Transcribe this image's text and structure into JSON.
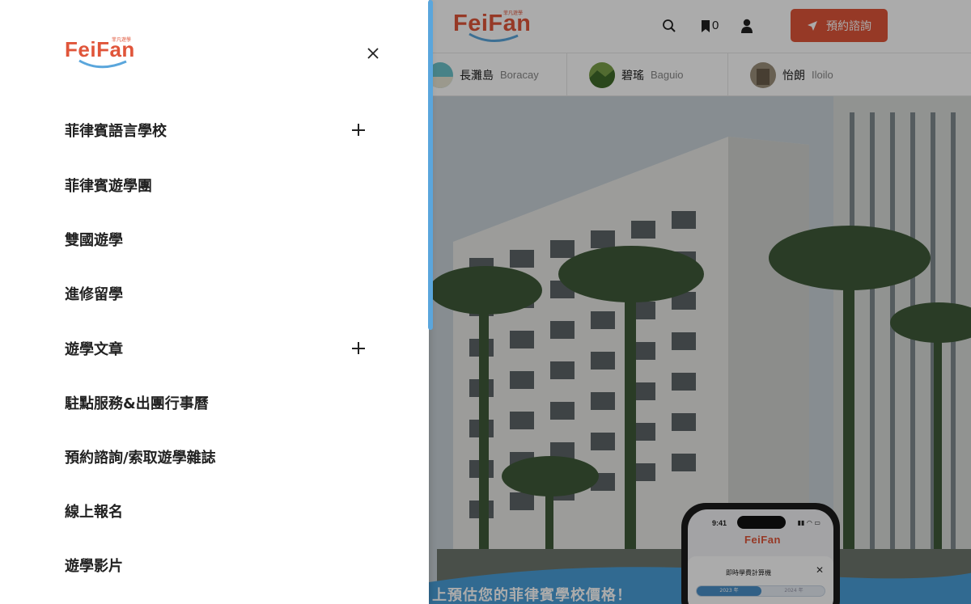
{
  "brand": {
    "name": "FeiFan",
    "tagline": "菲凡遊學",
    "primary_color": "#e0553a",
    "accent_color": "#5aa6dc"
  },
  "header": {
    "bookmark_count": "0",
    "cta_label": "預約諮詢",
    "icons": [
      "search-icon",
      "bookmark-icon",
      "user-icon",
      "send-icon"
    ]
  },
  "regions": [
    {
      "zh": "長灘島",
      "en": "Boracay"
    },
    {
      "zh": "碧瑤",
      "en": "Baguio"
    },
    {
      "zh": "怡朗",
      "en": "Iloilo"
    }
  ],
  "hero": {
    "caption": "上預估您的菲律賓學校價格！"
  },
  "phone": {
    "time": "9:41",
    "card_title": "即時學費計算機",
    "tabs": [
      "2023 年",
      "2024 年"
    ]
  },
  "drawer": {
    "menu": [
      {
        "label": "菲律賓語言學校",
        "expandable": true
      },
      {
        "label": "菲律賓遊學團",
        "expandable": false
      },
      {
        "label": "雙國遊學",
        "expandable": false
      },
      {
        "label": "進修留學",
        "expandable": false
      },
      {
        "label": "遊學文章",
        "expandable": true
      },
      {
        "label": "駐點服務&出團行事曆",
        "expandable": false
      },
      {
        "label": "預約諮詢/索取遊學雜誌",
        "expandable": false
      },
      {
        "label": "線上報名",
        "expandable": false
      },
      {
        "label": "遊學影片",
        "expandable": false
      }
    ]
  }
}
